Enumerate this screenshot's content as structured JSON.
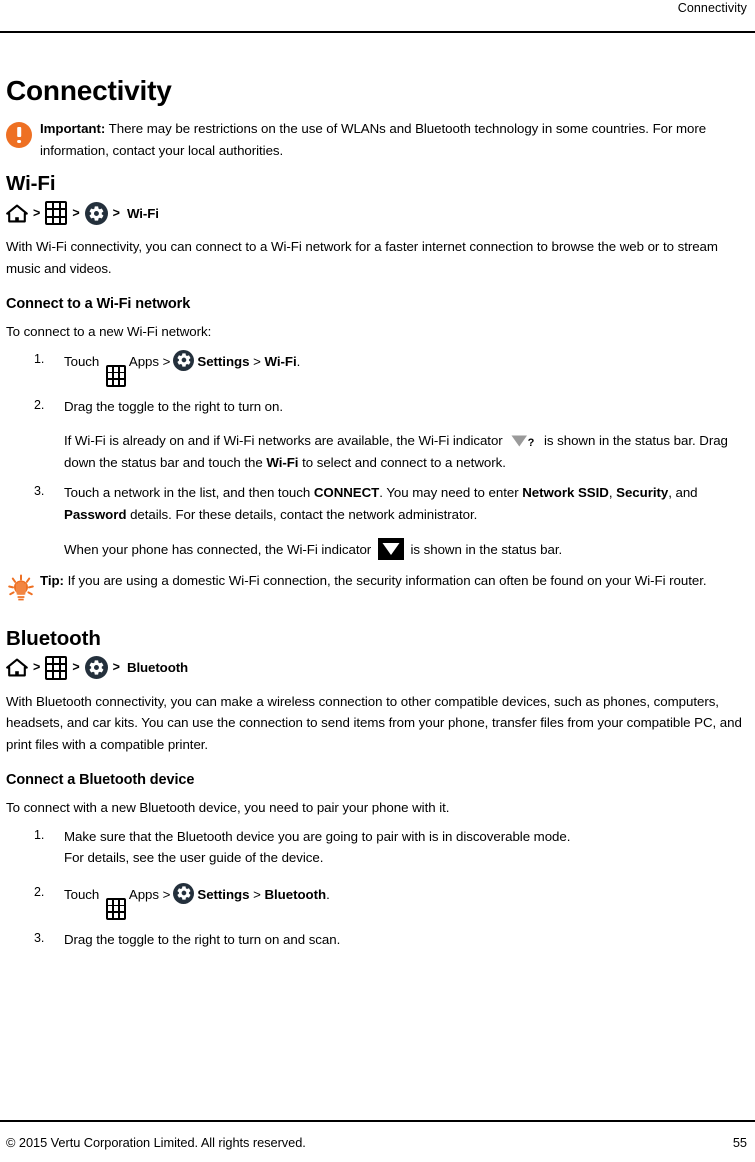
{
  "header": {
    "running_title": "Connectivity"
  },
  "page_title": "Connectivity",
  "important_callout": {
    "icon": "important-exclamation-icon",
    "label": "Important:",
    "text": " There may be restrictions on the use of WLANs and Bluetooth technology in some countries. For more information, contact your local authorities."
  },
  "wifi_section": {
    "title": "Wi-Fi",
    "breadcrumb": {
      "home_icon": "home-icon",
      "apps_icon": "apps-grid-icon",
      "settings_icon": "settings-gear-icon",
      "separator": ">",
      "last_label": "Wi-Fi"
    },
    "intro": "With Wi-Fi connectivity, you can connect to a Wi-Fi network for a faster internet connection to browse the web or to stream music and videos.",
    "subsection": {
      "title": "Connect to a Wi-Fi network",
      "lead": "To connect to a new Wi-Fi network:",
      "steps": [
        {
          "prefix": "Touch ",
          "apps_label": "Apps",
          "sep1": ">",
          "settings_label": "Settings",
          "sep2": ">",
          "target_label": "Wi-Fi",
          "suffix": "."
        },
        {
          "text": "Drag the toggle to the right to turn on.",
          "note_part1": "If Wi-Fi is already on and if Wi-Fi networks are available, the Wi-Fi indicator ",
          "note_icon": "wifi-question-indicator-icon",
          "note_part2": " is shown in the status bar. Drag down the status bar and touch the ",
          "note_bold": "Wi-Fi",
          "note_part3": " to select and connect to a network."
        },
        {
          "part1": "Touch a network in the list, and then touch ",
          "bold1": "CONNECT",
          "part2": ". You may need to enter ",
          "bold2": "Network SSID",
          "part3": ", ",
          "bold3": "Security",
          "part4": ", and ",
          "bold4": "Password",
          "part5": " details. For these details, contact the network administrator.",
          "note_part1": "When your phone has connected, the Wi-Fi indicator ",
          "note_icon": "wifi-connected-indicator-icon",
          "note_part2": " is shown in the status bar."
        }
      ]
    },
    "tip_callout": {
      "icon": "tip-lightbulb-icon",
      "label": "Tip:",
      "text": " If you are using a domestic Wi-Fi connection, the security information can often be found on your Wi-Fi router."
    }
  },
  "bluetooth_section": {
    "title": "Bluetooth",
    "breadcrumb": {
      "home_icon": "home-icon",
      "apps_icon": "apps-grid-icon",
      "settings_icon": "settings-gear-icon",
      "separator": ">",
      "last_label": "Bluetooth"
    },
    "intro": "With Bluetooth connectivity, you can make a wireless connection to other compatible devices, such as phones, computers, headsets, and car kits. You can use the connection to send items from your phone, transfer files from your compatible PC, and print files with a compatible printer.",
    "subsection": {
      "title": "Connect a Bluetooth device",
      "lead": "To connect with a new Bluetooth device, you need to pair your phone with it.",
      "steps": [
        {
          "line1": "Make sure that the Bluetooth device you are going to pair with is in discoverable mode.",
          "line2": "For details, see the user guide of the device."
        },
        {
          "prefix": "Touch ",
          "apps_label": "Apps",
          "sep1": ">",
          "settings_label": "Settings",
          "sep2": ">",
          "target_label": "Bluetooth",
          "suffix": "."
        },
        {
          "text": "Drag the toggle to the right to turn on and scan."
        }
      ]
    }
  },
  "footer": {
    "copyright": "© 2015 Vertu Corporation Limited. All rights reserved.",
    "page_number": "55"
  },
  "colors": {
    "accent_orange": "#ee7023",
    "icon_dark": "#24303c",
    "rule": "#000000"
  }
}
